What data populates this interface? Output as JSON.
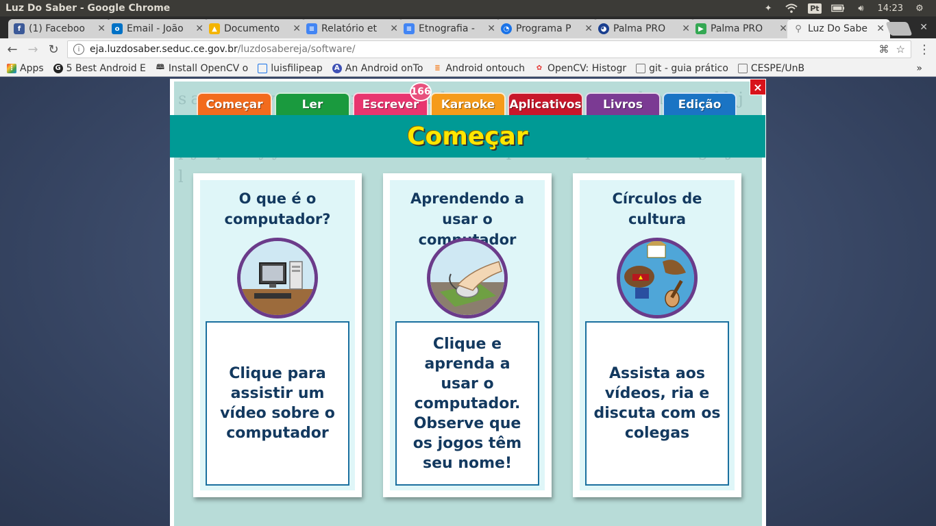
{
  "os": {
    "window_title": "Luz Do Saber - Google Chrome",
    "keyboard_layout": "Pt",
    "clock": "14:23"
  },
  "browser": {
    "tabs": [
      {
        "label": "(1) Faceboo",
        "icon": "facebook-icon",
        "color": "#3b5998"
      },
      {
        "label": "Email - João",
        "icon": "outlook-icon",
        "color": "#0072c6"
      },
      {
        "label": "Documento",
        "icon": "drive-icon",
        "color": "#f4b400"
      },
      {
        "label": "Relatório et",
        "icon": "docs-icon",
        "color": "#4285f4"
      },
      {
        "label": "Etnografia -",
        "icon": "docs-icon",
        "color": "#4285f4"
      },
      {
        "label": "Programa P",
        "icon": "circle-icon",
        "color": "#1a73e8"
      },
      {
        "label": "Palma PRO",
        "icon": "circle-icon",
        "color": "#1a3f8f"
      },
      {
        "label": "Palma PRO",
        "icon": "play-store-icon",
        "color": "#34a853"
      },
      {
        "label": "Luz Do Sabe",
        "icon": "search-icon",
        "color": "#777777",
        "active": true
      }
    ],
    "url_host": "eja.luzdosaber.seduc.ce.gov.br",
    "url_path": "/luzdosabereja/software/",
    "bookmarks": [
      {
        "label": "Apps",
        "icon": "apps-grid-icon",
        "color": "#e53935"
      },
      {
        "label": "5 Best Android E",
        "icon": "g-icon",
        "color": "#222222"
      },
      {
        "label": "Install OpenCV o",
        "icon": "bookmark-icon",
        "color": "#555555"
      },
      {
        "label": "luisfilipeap",
        "icon": "page-icon",
        "color": "#1a73e8"
      },
      {
        "label": "An Android onTo",
        "icon": "a-icon",
        "color": "#3f51b5"
      },
      {
        "label": "Android ontouch",
        "icon": "stackoverflow-icon",
        "color": "#f48024"
      },
      {
        "label": "OpenCV: Histogr",
        "icon": "opencv-icon",
        "color": "#e53935"
      },
      {
        "label": "git - guia prático",
        "icon": "page-icon",
        "color": "#777777"
      },
      {
        "label": "CESPE/UnB",
        "icon": "page-icon",
        "color": "#777777"
      }
    ]
  },
  "app": {
    "close_label": "×",
    "tabs": [
      {
        "label": "Começar",
        "color": "#f26b1d"
      },
      {
        "label": "Ler",
        "color": "#1a9a3e"
      },
      {
        "label": "Escrever",
        "color": "#e8356f"
      },
      {
        "label": "Karaoke",
        "color": "#f59b1a"
      },
      {
        "label": "Aplicativos",
        "color": "#c8172b"
      },
      {
        "label": "Livros",
        "color": "#7b3a93"
      },
      {
        "label": "Edição",
        "color": "#1a74c4"
      }
    ],
    "badge_count": "166",
    "banner_title": "Começar",
    "cards": [
      {
        "title": "O que é o computador?",
        "image": "computer-illustration",
        "description": "Clique para assistir um vídeo sobre o computador"
      },
      {
        "title": "Aprendendo a usar o computador",
        "image": "mouse-hand-illustration",
        "description": "Clique e aprenda a usar o computador. Observe que os jogos têm seu nome!"
      },
      {
        "title": "Círculos de cultura",
        "image": "culture-illustration",
        "description": "Assista aos vídeos, ria e discuta com os colegas"
      }
    ],
    "background_letters": "sacamovçssemnpaocadqwertyuiopzxcvbnmaçlkjhgfdsqçhcrttqqazxswedcvfrtgbSABERcuewvtiuopjepvdyyssaLUZDOSABEReqcaximpvnmzdrtghjkl"
  }
}
